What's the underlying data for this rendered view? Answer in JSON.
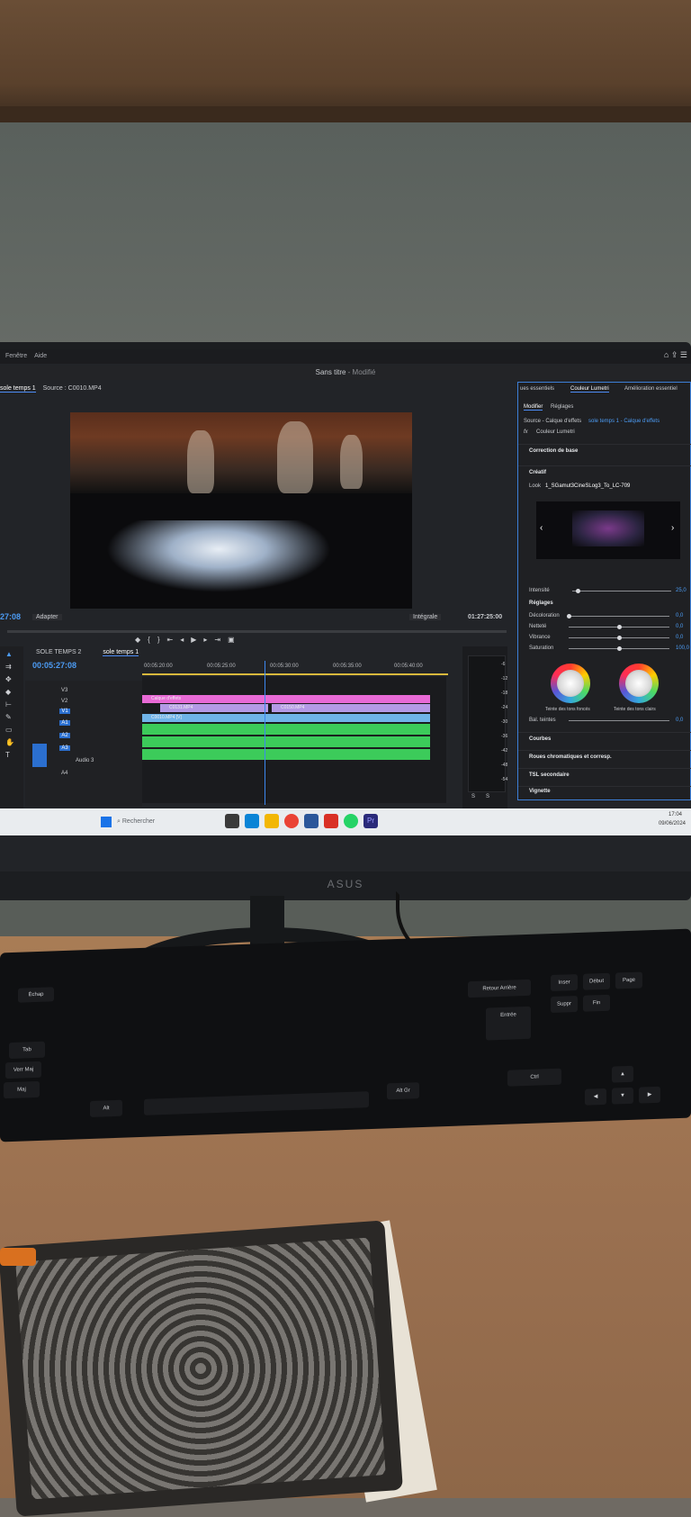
{
  "app": {
    "menu": [
      "Fenêtre",
      "Aide"
    ],
    "window_title": "Sans titre",
    "window_status": "- Modifié"
  },
  "program_monitor": {
    "tab_sequence": "sole temps 1",
    "tab_source": "Source : C0010.MP4",
    "timecode": "27:08",
    "fit": "Adapter",
    "quality": "Intégrale",
    "duration": "01:27:25:00"
  },
  "timeline": {
    "tabs": [
      "SOLE TEMPS 2",
      "sole temps 1"
    ],
    "timecode": "00:05:27:08",
    "ruler": [
      "00:05:20:00",
      "00:05:25:00",
      "00:05:30:00",
      "00:05:35:00",
      "00:05:40:00"
    ],
    "tracks_video": [
      "V3",
      "V2",
      "V1"
    ],
    "tracks_audio": [
      "A1",
      "A2",
      "A3",
      "A4"
    ],
    "audio3_label": "Audio 3",
    "clips": {
      "adjustment": "Calque d'effets",
      "v2_a": "C0131.MP4",
      "v2_b": "C0150.MP4",
      "v1": "C0010.MP4 [V]"
    },
    "meter_labels": [
      "-6",
      "-12",
      "-18",
      "-24",
      "-30",
      "-36",
      "-42",
      "-48",
      "-54"
    ],
    "meter_solo": [
      "S",
      "S"
    ]
  },
  "lumetri": {
    "tabs": [
      "ues essentiels",
      "Couleur Lumetri",
      "Amélioration essentiel"
    ],
    "subtabs": [
      "Modifier",
      "Réglages"
    ],
    "source": "Source - Calque d'effets",
    "source_link": "sole temps 1 - Calque d'effets",
    "fx": "fx",
    "effect": "Couleur Lumetri",
    "sections": {
      "basic": "Correction de base",
      "creative": "Créatif",
      "look_label": "Look",
      "look_value": "1_SGamut3CineSLog3_To_LC-709",
      "intensity_label": "Intensité",
      "intensity_value": "25,0",
      "adjustments": "Réglages",
      "curves": "Courbes",
      "wheels": "Roues chromatiques et corresp.",
      "hsl": "TSL secondaire",
      "vignette": "Vignette"
    },
    "sliders": [
      {
        "label": "Décoloration",
        "value": "0,0",
        "level": 0.0
      },
      {
        "label": "Netteté",
        "value": "0,0",
        "level": 0.5
      },
      {
        "label": "Vibrance",
        "value": "0,0",
        "level": 0.5
      },
      {
        "label": "Saturation",
        "value": "100,0",
        "level": 0.5
      }
    ],
    "wheel_labels": [
      "Teinte des tons foncés",
      "Teinte des tons clairs"
    ],
    "balance_label": "Bal. teintes",
    "balance_value": "0,0"
  },
  "taskbar": {
    "search_placeholder": "Rechercher",
    "time": "17:04",
    "date": "09/06/2024"
  },
  "monitor_brand": "ASUS",
  "keyboard": {
    "keys": [
      "Échap",
      "Tab",
      "Verr Maj",
      "Maj",
      "Ctrl",
      "Alt",
      "Alt Gr",
      "Entrée",
      "Retour Arrière",
      "Suppr",
      "Fin",
      "Inser",
      "Début",
      "Page"
    ]
  },
  "colors": {
    "accent": "#4c9cf5",
    "adjustment_clip": "#e86ad6",
    "v2_clip": "#b49ae6",
    "v1_clip": "#6fb4e8",
    "audio_clip": "#3ccb5a"
  }
}
